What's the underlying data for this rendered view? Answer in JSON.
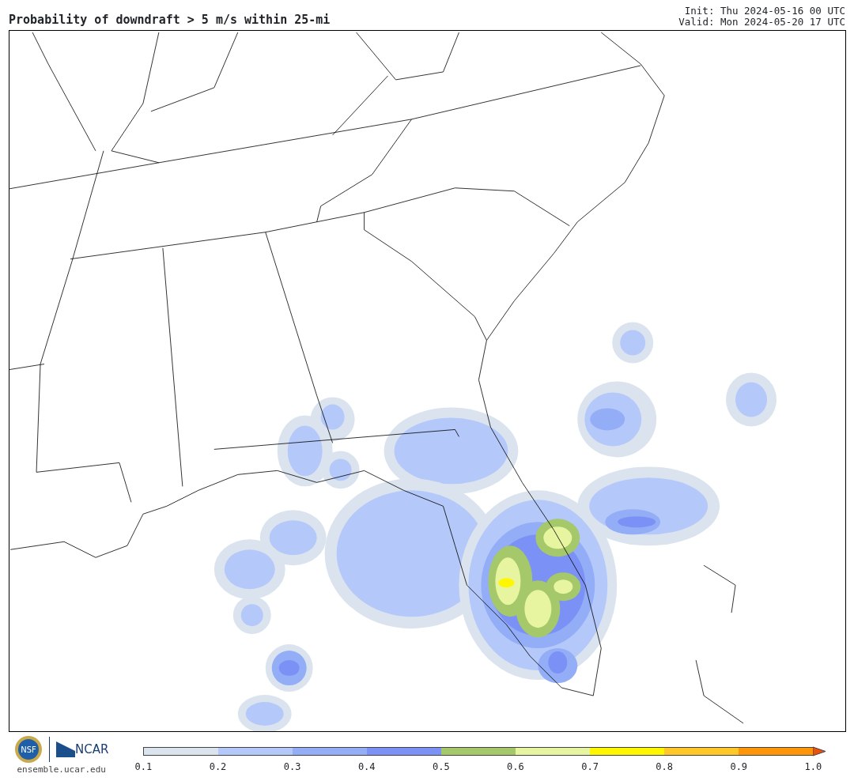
{
  "title": "Probability of downdraft > 5 m/s within 25-mi",
  "init": "Init: Thu 2024-05-16 00 UTC",
  "valid": "Valid: Mon 2024-05-20 17 UTC",
  "logos": {
    "nsf": "NSF",
    "ncar": "NCAR",
    "url": "ensemble.ucar.edu"
  },
  "colorbar": {
    "segments": [
      {
        "color": "#dbe4ee"
      },
      {
        "color": "#b4c8fa"
      },
      {
        "color": "#93aef7"
      },
      {
        "color": "#7c91f5"
      },
      {
        "color": "#a5c86a"
      },
      {
        "color": "#e8f5a0"
      },
      {
        "color": "#fff700"
      },
      {
        "color": "#ffc828"
      },
      {
        "color": "#ff960a"
      },
      {
        "kind": "arrow",
        "color": "#e8520a"
      }
    ],
    "ticks": [
      "0.1",
      "0.2",
      "0.3",
      "0.4",
      "0.5",
      "0.6",
      "0.7",
      "0.8",
      "0.9",
      "1.0"
    ]
  }
}
